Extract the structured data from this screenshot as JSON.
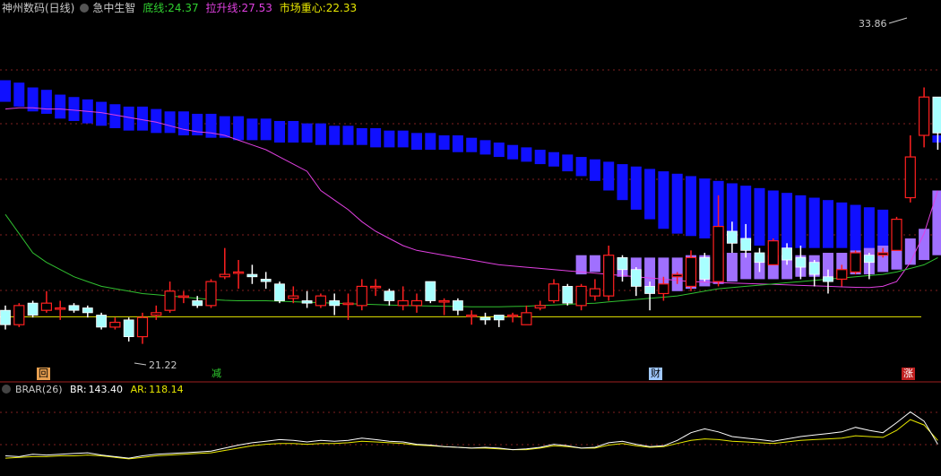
{
  "header": {
    "stock_name": "神州数码(日线)",
    "indicator_name": "急中生智",
    "line1_label": "底线:",
    "line1_value": "24.37",
    "line2_label": "拉升线:",
    "line2_value": "27.53",
    "line3_label": "市场重心:",
    "line3_value": "22.33"
  },
  "markers": {
    "m1": "回",
    "m2": "减",
    "m3": "财",
    "m4": "涨"
  },
  "sub": {
    "name": "BRAR(26)",
    "br_label": "BR:",
    "br_value": "143.40",
    "ar_label": "AR:",
    "ar_value": "118.14"
  },
  "colors": {
    "up": "#ff2020",
    "down": "#ffffff",
    "down_fill": "#a8ffff",
    "pressure": "#1010ff",
    "support": "#a070ff",
    "magenta": "#e040e0",
    "green": "#30c030",
    "yellow": "#e8e800",
    "grid": "#802020",
    "br": "#ffffff",
    "ar": "#e8e800"
  },
  "chart_data": {
    "type": "candlestick",
    "price_range": [
      20.4,
      34.8
    ],
    "annotations": {
      "high_label": "33.86",
      "low_label": "21.22",
      "high": 33.86,
      "low": 21.22
    },
    "yellow_line": 22.33,
    "candles": [
      [
        22.6,
        22.0,
        22.8,
        21.8
      ],
      [
        22.0,
        22.8,
        22.9,
        21.9
      ],
      [
        22.9,
        22.4,
        23.0,
        22.3
      ],
      [
        22.6,
        22.9,
        23.4,
        22.5
      ],
      [
        22.7,
        22.7,
        23.0,
        22.2
      ],
      [
        22.8,
        22.6,
        22.9,
        22.5
      ],
      [
        22.7,
        22.5,
        22.8,
        22.3
      ],
      [
        22.4,
        21.9,
        22.5,
        21.8
      ],
      [
        21.9,
        22.1,
        22.3,
        21.8
      ],
      [
        22.2,
        21.5,
        22.3,
        21.3
      ],
      [
        21.5,
        22.3,
        22.5,
        21.2
      ],
      [
        22.4,
        22.5,
        22.8,
        22.2
      ],
      [
        22.6,
        23.4,
        23.8,
        22.5
      ],
      [
        23.2,
        23.2,
        23.4,
        22.9
      ],
      [
        23.0,
        22.8,
        23.2,
        22.7
      ],
      [
        22.8,
        23.8,
        23.9,
        22.7
      ],
      [
        24.0,
        24.1,
        25.2,
        23.9
      ],
      [
        24.2,
        24.2,
        24.7,
        23.5
      ],
      [
        24.1,
        24.0,
        24.5,
        23.7
      ],
      [
        23.9,
        23.8,
        24.2,
        23.5
      ],
      [
        23.7,
        23.0,
        23.8,
        22.9
      ],
      [
        23.1,
        23.2,
        23.6,
        22.9
      ],
      [
        23.0,
        22.9,
        23.4,
        22.7
      ],
      [
        22.8,
        23.2,
        23.3,
        22.7
      ],
      [
        23.0,
        22.8,
        23.3,
        22.4
      ],
      [
        22.9,
        22.9,
        23.3,
        22.2
      ],
      [
        22.8,
        23.6,
        23.9,
        22.6
      ],
      [
        23.6,
        23.6,
        23.9,
        23.2
      ],
      [
        23.4,
        23.0,
        23.5,
        22.8
      ],
      [
        22.8,
        23.0,
        23.6,
        22.6
      ],
      [
        22.8,
        23.0,
        23.3,
        22.5
      ],
      [
        23.8,
        23.0,
        23.8,
        22.9
      ],
      [
        23.0,
        23.0,
        23.1,
        22.4
      ],
      [
        23.0,
        22.6,
        23.1,
        22.4
      ],
      [
        22.4,
        22.4,
        22.6,
        22.0
      ],
      [
        22.3,
        22.2,
        22.5,
        22.0
      ],
      [
        22.4,
        22.2,
        22.4,
        21.9
      ],
      [
        22.4,
        22.4,
        22.5,
        22.1
      ],
      [
        22.0,
        22.5,
        22.8,
        22.0
      ],
      [
        22.7,
        22.8,
        23.0,
        22.6
      ],
      [
        23.0,
        23.7,
        23.9,
        22.9
      ],
      [
        23.6,
        22.9,
        23.7,
        22.8
      ],
      [
        22.8,
        23.6,
        23.7,
        22.6
      ],
      [
        23.2,
        23.5,
        23.9,
        23.0
      ],
      [
        23.2,
        24.9,
        25.3,
        23.0
      ],
      [
        24.8,
        24.3,
        24.9,
        23.8
      ],
      [
        24.3,
        23.6,
        24.4,
        23.2
      ],
      [
        23.6,
        23.3,
        23.8,
        22.6
      ],
      [
        23.3,
        23.7,
        24.0,
        23.0
      ],
      [
        24.0,
        24.1,
        24.2,
        23.7
      ],
      [
        23.6,
        24.8,
        25.1,
        23.4
      ],
      [
        24.8,
        23.9,
        25.0,
        23.8
      ],
      [
        23.8,
        26.1,
        27.4,
        23.6
      ],
      [
        25.9,
        25.4,
        26.3,
        25.0
      ],
      [
        25.6,
        25.1,
        26.2,
        24.8
      ],
      [
        25.0,
        24.6,
        25.2,
        24.2
      ],
      [
        24.5,
        25.5,
        25.6,
        24.5
      ],
      [
        25.2,
        24.7,
        25.4,
        24.5
      ],
      [
        24.8,
        24.4,
        25.3,
        23.9
      ],
      [
        24.6,
        24.1,
        24.7,
        23.6
      ],
      [
        24.0,
        23.8,
        24.3,
        23.3
      ],
      [
        23.9,
        24.3,
        24.5,
        23.6
      ],
      [
        24.2,
        25.0,
        25.1,
        24.1
      ],
      [
        24.9,
        24.6,
        25.0,
        23.9
      ],
      [
        24.9,
        25.0,
        25.2,
        24.8
      ],
      [
        25.1,
        26.4,
        26.5,
        25.1
      ],
      [
        27.3,
        29.0,
        29.9,
        27.1
      ],
      [
        29.9,
        31.5,
        31.9,
        29.4
      ],
      [
        31.5,
        30.0,
        31.5,
        29.3
      ]
    ],
    "magenta_line": [
      31.0,
      31.05,
      31.05,
      31.0,
      31.0,
      30.95,
      30.9,
      30.85,
      30.75,
      30.65,
      30.55,
      30.45,
      30.3,
      30.15,
      30.05,
      30.0,
      29.9,
      29.7,
      29.5,
      29.3,
      29.0,
      28.7,
      28.4,
      27.6,
      27.2,
      26.8,
      26.3,
      25.9,
      25.6,
      25.3,
      25.1,
      25.0,
      24.9,
      24.8,
      24.7,
      24.6,
      24.5,
      24.45,
      24.4,
      24.35,
      24.3,
      24.25,
      24.2,
      24.15,
      24.1,
      24.05,
      24.0,
      23.95,
      23.9,
      23.85,
      23.8,
      23.78,
      23.76,
      23.74,
      23.72,
      23.7,
      23.68,
      23.66,
      23.64,
      23.62,
      23.6,
      23.58,
      23.56,
      23.55,
      23.6,
      23.8,
      24.6,
      25.8,
      27.6
    ],
    "green_line": [
      26.6,
      25.8,
      25.0,
      24.6,
      24.3,
      24.0,
      23.8,
      23.6,
      23.5,
      23.4,
      23.3,
      23.25,
      23.2,
      23.15,
      23.1,
      23.05,
      23.02,
      23.0,
      23.0,
      23.0,
      22.98,
      22.96,
      22.94,
      22.92,
      22.9,
      22.88,
      22.86,
      22.84,
      22.82,
      22.8,
      22.79,
      22.78,
      22.77,
      22.76,
      22.75,
      22.75,
      22.75,
      22.76,
      22.77,
      22.8,
      22.82,
      22.85,
      22.88,
      22.9,
      22.95,
      23.0,
      23.05,
      23.1,
      23.15,
      23.2,
      23.3,
      23.4,
      23.5,
      23.55,
      23.6,
      23.65,
      23.7,
      23.75,
      23.8,
      23.85,
      23.9,
      23.95,
      24.0,
      24.05,
      24.1,
      24.2,
      24.35,
      24.5,
      24.8
    ],
    "pressure_bars": [
      [
        32.2,
        31.3
      ],
      [
        32.1,
        31.1
      ],
      [
        31.9,
        30.9
      ],
      [
        31.8,
        30.8
      ],
      [
        31.6,
        30.6
      ],
      [
        31.5,
        30.5
      ],
      [
        31.4,
        30.4
      ],
      [
        31.3,
        30.3
      ],
      [
        31.2,
        30.2
      ],
      [
        31.1,
        30.1
      ],
      [
        31.1,
        30.1
      ],
      [
        31.0,
        30.0
      ],
      [
        30.9,
        30.0
      ],
      [
        30.9,
        29.9
      ],
      [
        30.8,
        29.9
      ],
      [
        30.8,
        29.8
      ],
      [
        30.7,
        29.8
      ],
      [
        30.7,
        29.7
      ],
      [
        30.6,
        29.7
      ],
      [
        30.6,
        29.7
      ],
      [
        30.5,
        29.6
      ],
      [
        30.5,
        29.6
      ],
      [
        30.4,
        29.6
      ],
      [
        30.4,
        29.5
      ],
      [
        30.3,
        29.5
      ],
      [
        30.3,
        29.5
      ],
      [
        30.2,
        29.5
      ],
      [
        30.2,
        29.4
      ],
      [
        30.1,
        29.4
      ],
      [
        30.1,
        29.4
      ],
      [
        30.0,
        29.3
      ],
      [
        30.0,
        29.3
      ],
      [
        29.9,
        29.3
      ],
      [
        29.9,
        29.2
      ],
      [
        29.8,
        29.2
      ],
      [
        29.7,
        29.1
      ],
      [
        29.6,
        29.0
      ],
      [
        29.5,
        28.9
      ],
      [
        29.4,
        28.8
      ],
      [
        29.3,
        28.7
      ],
      [
        29.2,
        28.6
      ],
      [
        29.1,
        28.4
      ],
      [
        29.0,
        28.2
      ],
      [
        28.9,
        28.0
      ],
      [
        28.8,
        27.6
      ],
      [
        28.7,
        27.2
      ],
      [
        28.6,
        26.8
      ],
      [
        28.5,
        26.4
      ],
      [
        28.4,
        26.0
      ],
      [
        28.3,
        25.8
      ],
      [
        28.2,
        25.7
      ],
      [
        28.1,
        25.6
      ],
      [
        28.0,
        25.5
      ],
      [
        27.9,
        25.4
      ],
      [
        27.8,
        25.4
      ],
      [
        27.7,
        25.3
      ],
      [
        27.6,
        25.3
      ],
      [
        27.5,
        25.2
      ],
      [
        27.4,
        25.2
      ],
      [
        27.3,
        25.2
      ],
      [
        27.2,
        25.2
      ],
      [
        27.1,
        25.2
      ],
      [
        27.0,
        25.1
      ],
      [
        26.9,
        25.1
      ],
      [
        26.8,
        25.1
      ],
      [
        null,
        null
      ],
      [
        null,
        null
      ],
      [
        null,
        null
      ],
      [
        29.9,
        29.6
      ]
    ],
    "support_bars": [
      [
        42,
        24.9,
        24.1
      ],
      [
        43,
        24.9,
        24.2
      ],
      [
        44,
        24.8,
        23.9
      ],
      [
        45,
        24.8,
        24.0
      ],
      [
        46,
        24.8,
        23.9
      ],
      [
        47,
        24.8,
        23.6
      ],
      [
        48,
        24.8,
        23.5
      ],
      [
        49,
        24.8,
        23.4
      ],
      [
        50,
        24.9,
        23.5
      ],
      [
        51,
        24.9,
        23.6
      ],
      [
        52,
        25.0,
        23.7
      ],
      [
        53,
        25.0,
        23.8
      ],
      [
        54,
        25.0,
        23.9
      ],
      [
        55,
        24.9,
        23.9
      ],
      [
        56,
        24.9,
        23.9
      ],
      [
        57,
        24.9,
        23.9
      ],
      [
        58,
        24.9,
        24.0
      ],
      [
        59,
        24.9,
        24.0
      ],
      [
        60,
        25.0,
        24.0
      ],
      [
        61,
        25.0,
        24.1
      ],
      [
        62,
        25.1,
        24.1
      ],
      [
        63,
        25.2,
        24.1
      ],
      [
        64,
        25.3,
        24.2
      ],
      [
        65,
        25.4,
        24.3
      ],
      [
        66,
        25.6,
        24.5
      ],
      [
        67,
        26.0,
        24.7
      ],
      [
        68,
        27.6,
        24.9
      ]
    ],
    "br_series": [
      25,
      24,
      27,
      26,
      27,
      28,
      29,
      26,
      24,
      22,
      25,
      27,
      28,
      29,
      30,
      31,
      35,
      39,
      42,
      44,
      46,
      45,
      43,
      45,
      44,
      45,
      48,
      46,
      44,
      43,
      40,
      39,
      37,
      36,
      35,
      36,
      35,
      33,
      34,
      36,
      40,
      38,
      35,
      36,
      42,
      44,
      40,
      37,
      38,
      45,
      55,
      60,
      56,
      50,
      48,
      46,
      44,
      47,
      50,
      52,
      54,
      56,
      62,
      58,
      55,
      68,
      82,
      70,
      40
    ],
    "ar_series": [
      22,
      23,
      24,
      24,
      25,
      25,
      26,
      25,
      23,
      21,
      23,
      25,
      26,
      27,
      28,
      29,
      32,
      35,
      38,
      40,
      41,
      41,
      40,
      41,
      41,
      42,
      44,
      43,
      42,
      41,
      39,
      38,
      37,
      36,
      35,
      35,
      34,
      33,
      33,
      35,
      38,
      37,
      35,
      35,
      39,
      41,
      38,
      36,
      37,
      41,
      45,
      47,
      46,
      44,
      43,
      42,
      41,
      43,
      45,
      46,
      47,
      48,
      51,
      50,
      49,
      58,
      72,
      65,
      45
    ],
    "sub_range": [
      0,
      100
    ]
  }
}
